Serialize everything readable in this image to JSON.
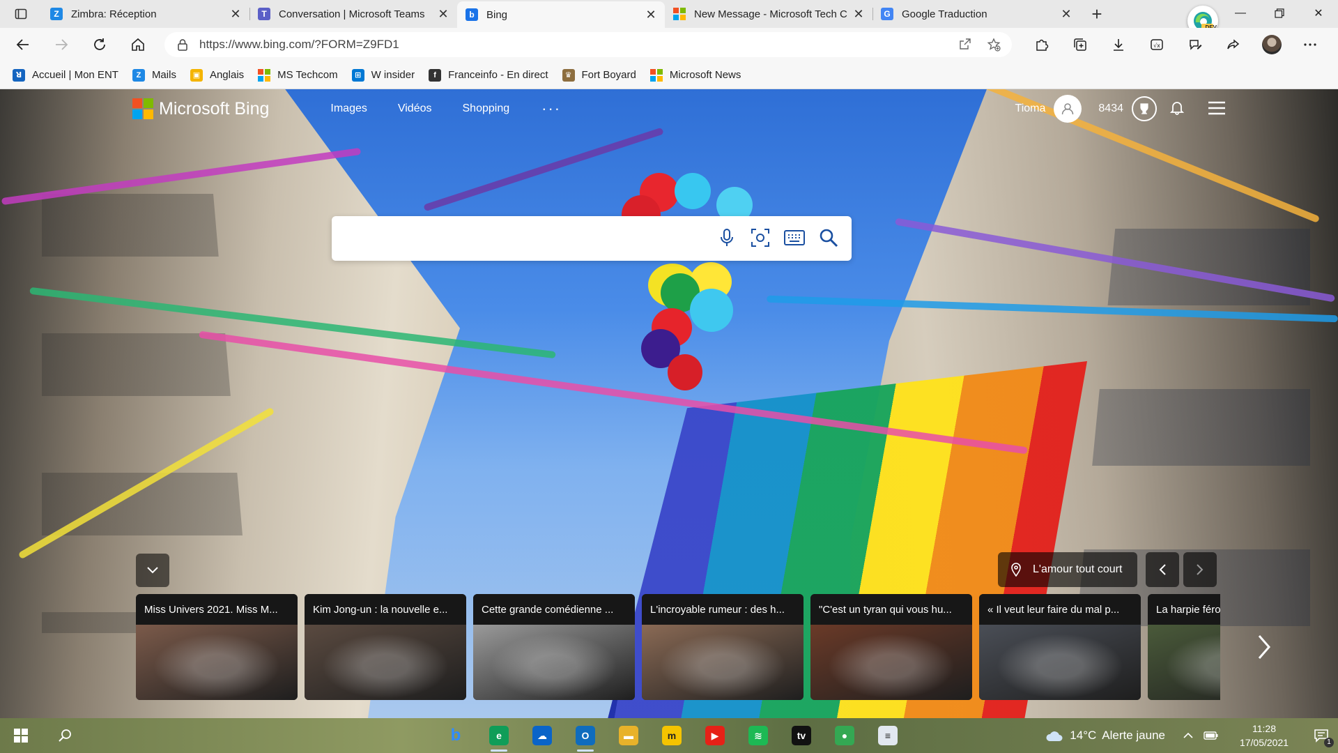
{
  "tabs": [
    {
      "title": "Zimbra: Réception",
      "icon": "zimbra-icon",
      "color": "#1e88e5",
      "glyph": "Z"
    },
    {
      "title": "Conversation | Microsoft Teams",
      "icon": "teams-icon",
      "color": "#5b5fc7",
      "glyph": "T"
    },
    {
      "title": "Bing",
      "icon": "bing-icon",
      "color": "#1a73e8",
      "glyph": "b",
      "active": true
    },
    {
      "title": "New Message - Microsoft Tech C",
      "icon": "microsoft-icon",
      "color": "#f25022",
      "glyph": ""
    },
    {
      "title": "Google Traduction",
      "icon": "google-translate-icon",
      "color": "#4285f4",
      "glyph": "G"
    }
  ],
  "toolbar": {
    "url": "https://www.bing.com/?FORM=Z9FD1",
    "profile_badge": "DEV"
  },
  "favorites": [
    {
      "label": "Accueil | Mon ENT",
      "icon": "ent-icon",
      "color": "#1565c0",
      "glyph": "ꓤ"
    },
    {
      "label": "Mails",
      "icon": "zimbra-icon",
      "color": "#1e88e5",
      "glyph": "Z"
    },
    {
      "label": "Anglais",
      "icon": "anglais-icon",
      "color": "#f4b400",
      "glyph": "▣"
    },
    {
      "label": "MS Techcom",
      "icon": "microsoft-icon",
      "color": "",
      "glyph": ""
    },
    {
      "label": "W insider",
      "icon": "windows-icon",
      "color": "#0078d4",
      "glyph": "⊞"
    },
    {
      "label": "Franceinfo - En direct",
      "icon": "franceinfo-icon",
      "color": "#333333",
      "glyph": "f"
    },
    {
      "label": "Fort Boyard",
      "icon": "fort-boyard-icon",
      "color": "#8d6e3f",
      "glyph": "♛"
    },
    {
      "label": "Microsoft News",
      "icon": "microsoft-icon",
      "color": "",
      "glyph": ""
    }
  ],
  "bing": {
    "logo": "Microsoft Bing",
    "nav": [
      "Images",
      "Vidéos",
      "Shopping"
    ],
    "more": "···",
    "user_name": "Tioma",
    "points": "8434",
    "search_placeholder": "",
    "location_label": "L'amour tout court"
  },
  "news_cards": [
    {
      "title": "Miss Univers 2021. Miss M...",
      "color": "#7b5a4a"
    },
    {
      "title": "Kim Jong-un : la nouvelle e...",
      "color": "#5a4a40"
    },
    {
      "title": "Cette grande comédienne ...",
      "color": "#9a9a9a"
    },
    {
      "title": "L'incroyable rumeur : des h...",
      "color": "#8a6a55"
    },
    {
      "title": "\"C'est un tyran qui vous hu...",
      "color": "#6a3a28"
    },
    {
      "title": "« Il veut leur faire du mal p...",
      "color": "#4a4e56"
    },
    {
      "title": "La harpie féroce",
      "color": "#4a5a3a"
    }
  ],
  "taskbar": {
    "weather_temp": "14°C",
    "weather_text": "Alerte jaune",
    "time": "11:28",
    "date": "17/05/2021",
    "notifications": "1",
    "apps": [
      {
        "name": "bing-app",
        "glyph": "b",
        "color": "#1a73e8",
        "running": false
      },
      {
        "name": "edge-dev-app",
        "glyph": "e",
        "color": "#0f9d58",
        "running": true
      },
      {
        "name": "onedrive-app",
        "glyph": "☁",
        "color": "#0a64c8",
        "running": false
      },
      {
        "name": "outlook-app",
        "glyph": "O",
        "color": "#0f6cbd",
        "running": true
      },
      {
        "name": "file-explorer-app",
        "glyph": "▬",
        "color": "#e8b22a",
        "running": false
      },
      {
        "name": "m-app",
        "glyph": "m",
        "color": "#f5c400",
        "running": false
      },
      {
        "name": "youtube-app",
        "glyph": "▶",
        "color": "#e62117",
        "running": false
      },
      {
        "name": "spotify-app",
        "glyph": "≋",
        "color": "#1db954",
        "running": false
      },
      {
        "name": "apple-tv-app",
        "glyph": "tv",
        "color": "#111111",
        "running": false
      },
      {
        "name": "maps-app",
        "glyph": "●",
        "color": "#34a853",
        "running": false
      },
      {
        "name": "notepad-app",
        "glyph": "≡",
        "color": "#e2e8f0",
        "running": false
      }
    ]
  }
}
